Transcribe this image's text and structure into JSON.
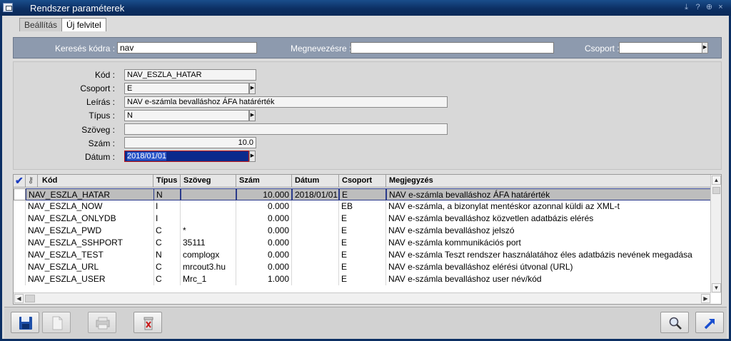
{
  "window": {
    "title": "Rendszer paraméterek"
  },
  "tabs": [
    {
      "label": "Beállítás"
    },
    {
      "label": "Új felvitel"
    }
  ],
  "search": {
    "code_label": "Keresés kódra :",
    "code_value": "nav",
    "name_label": "Megnevezésre :",
    "name_value": "",
    "group_label": "Csoport :",
    "group_value": ""
  },
  "form": {
    "kod_label": "Kód :",
    "kod_value": "NAV_ESZLA_HATAR",
    "csoport_label": "Csoport :",
    "csoport_value": "E",
    "leiras_label": "Leírás :",
    "leiras_value": "NAV e-számla bevalláshoz ÁFA határérték",
    "tipus_label": "Típus :",
    "tipus_value": "N",
    "szoveg_label": "Szöveg :",
    "szoveg_value": "",
    "szam_label": "Szám :",
    "szam_value": "10.0",
    "datum_label": "Dátum :",
    "datum_value": "2018/01/01"
  },
  "grid": {
    "columns": [
      "Kód",
      "Típus",
      "Szöveg",
      "Szám",
      "Dátum",
      "Csoport",
      "Megjegyzés"
    ],
    "rows": [
      [
        "NAV_ESZLA_HATAR",
        "N",
        "",
        "10.000",
        "2018/01/01",
        "E",
        "NAV e-számla bevalláshoz ÁFA határérték"
      ],
      [
        "NAV_ESZLA_NOW",
        "I",
        "",
        "0.000",
        "",
        "EB",
        "NAV e-számla, a bizonylat mentéskor azonnal küldi az XML-t"
      ],
      [
        "NAV_ESZLA_ONLYDB",
        "I",
        "",
        "0.000",
        "",
        "E",
        "NAV e-számla bevalláshoz közvetlen adatbázis elérés"
      ],
      [
        "NAV_ESZLA_PWD",
        "C",
        "*",
        "0.000",
        "",
        "E",
        "NAV e-számla bevalláshoz jelszó"
      ],
      [
        "NAV_ESZLA_SSHPORT",
        "C",
        "35111",
        "0.000",
        "",
        "E",
        "NAV e-számla kommunikációs port"
      ],
      [
        "NAV_ESZLA_TEST",
        "N",
        "complogx",
        "0.000",
        "",
        "E",
        "NAV e-számla Teszt rendszer használatához éles adatbázis nevének megadása"
      ],
      [
        "NAV_ESZLA_URL",
        "C",
        "mrcout3.hu",
        "0.000",
        "",
        "E",
        "NAV e-számla bevalláshoz elérési útvonal (URL)"
      ],
      [
        "NAV_ESZLA_USER",
        "C",
        "Mrc_1",
        "1.000",
        "",
        "E",
        "NAV e-számla bevalláshoz user név/kód"
      ]
    ]
  },
  "footer": {
    "icons": [
      "save-icon",
      "new-document-icon",
      "printer-icon",
      "delete-icon",
      "search-icon",
      "exit-arrow-icon"
    ]
  }
}
